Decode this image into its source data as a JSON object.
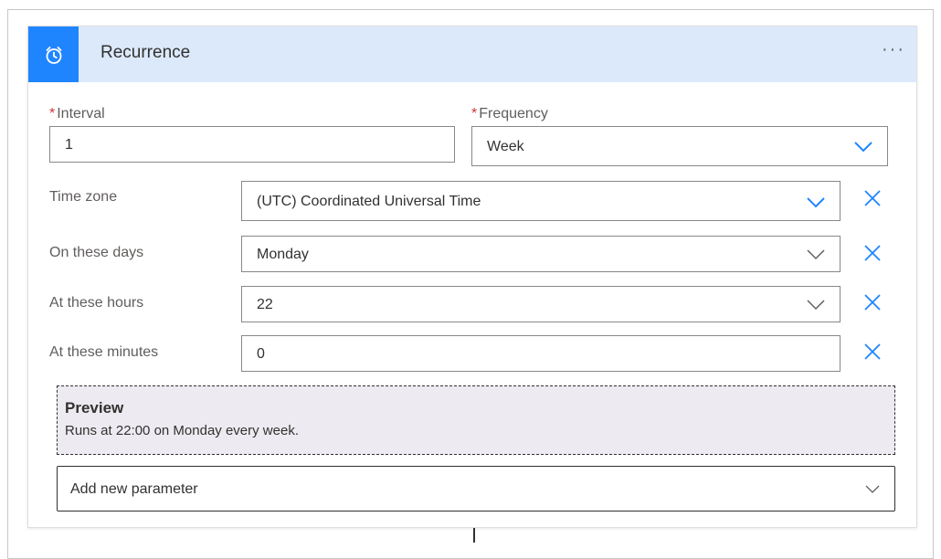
{
  "card": {
    "title": "Recurrence",
    "more": "···",
    "icon": "alarm-clock-icon"
  },
  "interval": {
    "label": "Interval",
    "required": "*",
    "value": "1"
  },
  "frequency": {
    "label": "Frequency",
    "required": "*",
    "value": "Week"
  },
  "rows": {
    "timezone": {
      "label": "Time zone",
      "value": "(UTC) Coordinated Universal Time"
    },
    "days": {
      "label": "On these days",
      "value": "Monday"
    },
    "hours": {
      "label": "At these hours",
      "value": "22"
    },
    "minutes": {
      "label": "At these minutes",
      "value": "0"
    }
  },
  "preview": {
    "title": "Preview",
    "text": "Runs at 22:00 on Monday every week."
  },
  "add_parameter": {
    "label": "Add new parameter"
  },
  "colors": {
    "accent": "#1f85ff",
    "header_bg": "#dbe9fb",
    "required": "#d13438",
    "preview_bg": "#edebf1"
  }
}
